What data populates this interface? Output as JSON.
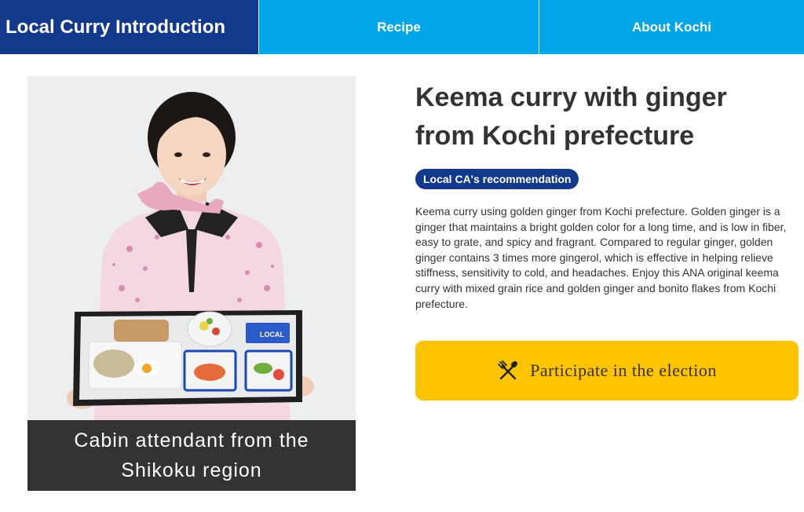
{
  "nav": {
    "brand": "Local Curry Introduction",
    "tabs": [
      {
        "label": "Recipe"
      },
      {
        "label": "About Kochi"
      }
    ]
  },
  "hero": {
    "caption": "Cabin attendant from the Shikoku region",
    "tray_lid_text": "LOCAL"
  },
  "main": {
    "title": "Keema curry with ginger from Kochi prefecture",
    "badge": "Local CA's recommendation",
    "description": "Keema curry using golden ginger from Kochi prefecture. Golden ginger is a ginger that maintains a bright golden color for a long time, and is low in fiber, easy to grate, and spicy and fragrant. Compared to regular ginger, golden ginger contains 3 times more gingerol, which is effective in helping relieve stiffness, sensitivity to cold, and headaches. Enjoy this ANA original keema curry with mixed grain rice and golden ginger and bonito flakes from Kochi prefecture.",
    "cta_label": "Participate in the election",
    "cta_icon": "fork-knife-icon"
  },
  "colors": {
    "nav_brand_bg": "#13398c",
    "nav_tab_bg": "#00a6e8",
    "badge_bg": "#13398c",
    "cta_bg": "#ffc300",
    "caption_bg": "#333333",
    "text": "#333333"
  }
}
